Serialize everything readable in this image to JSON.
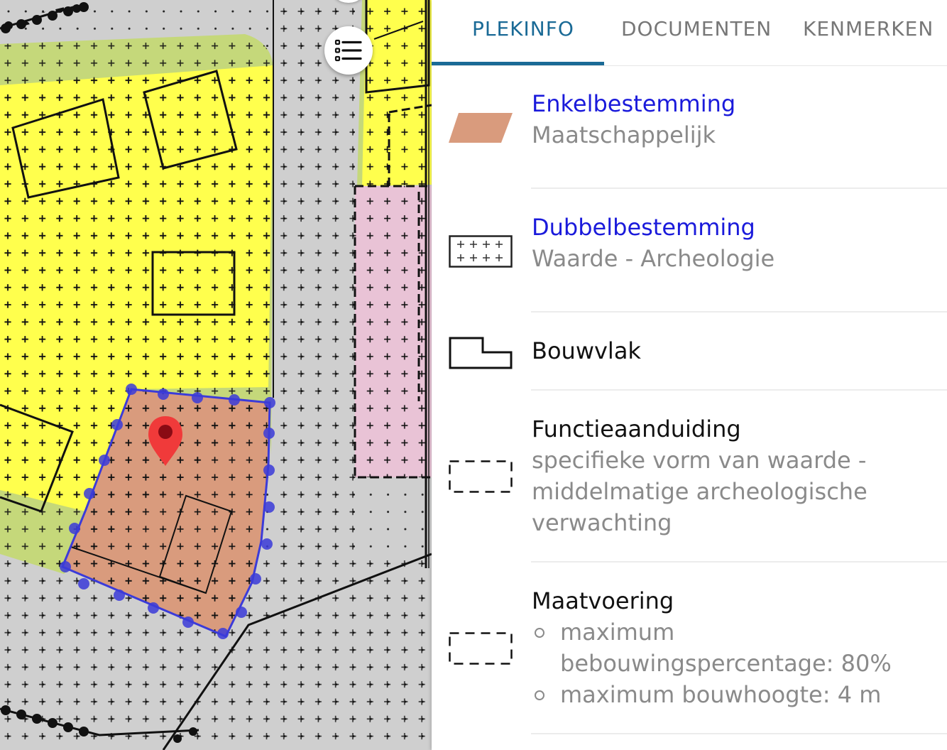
{
  "tabs": [
    {
      "label": "PLEKINFO",
      "active": true
    },
    {
      "label": "DOCUMENTEN",
      "active": false
    },
    {
      "label": "KENMERKEN",
      "active": false
    }
  ],
  "legend_entries": [
    {
      "title": "Enkelbestemming",
      "subtitle": "Maatschappelijk",
      "icon": "enkelbestemming-swatch-icon"
    },
    {
      "title": "Dubbelbestemming",
      "subtitle": "Waarde - Archeologie",
      "icon": "dubbelbestemming-cross-hatch-icon"
    },
    {
      "title": "Bouwvlak",
      "icon": "bouwvlak-outline-icon"
    },
    {
      "title": "Functieaanduiding",
      "description": "specifieke vorm van waarde - middelmatige archeologische verwachting",
      "icon": "functieaanduiding-dashed-icon"
    },
    {
      "title": "Maatvoering",
      "items": [
        "maximum bebouwingspercentage: 80%",
        "maximum bouwhoogte: 4 m"
      ],
      "icon": "maatvoering-dashed-icon"
    }
  ],
  "map": {
    "controls": {
      "legend_toggle_icon": "list-icon"
    },
    "marker_icon": "location-pin-icon"
  },
  "colors": {
    "accent": "#1a6a96",
    "link": "#1a1adb",
    "maatschappelijk": "#d99b7d",
    "yellow_zone": "#ffff4d",
    "green_zone": "#c5d87a",
    "pink_zone": "#e9c3d6",
    "selection": "#3b3bd9",
    "marker": "#f03a3a"
  }
}
